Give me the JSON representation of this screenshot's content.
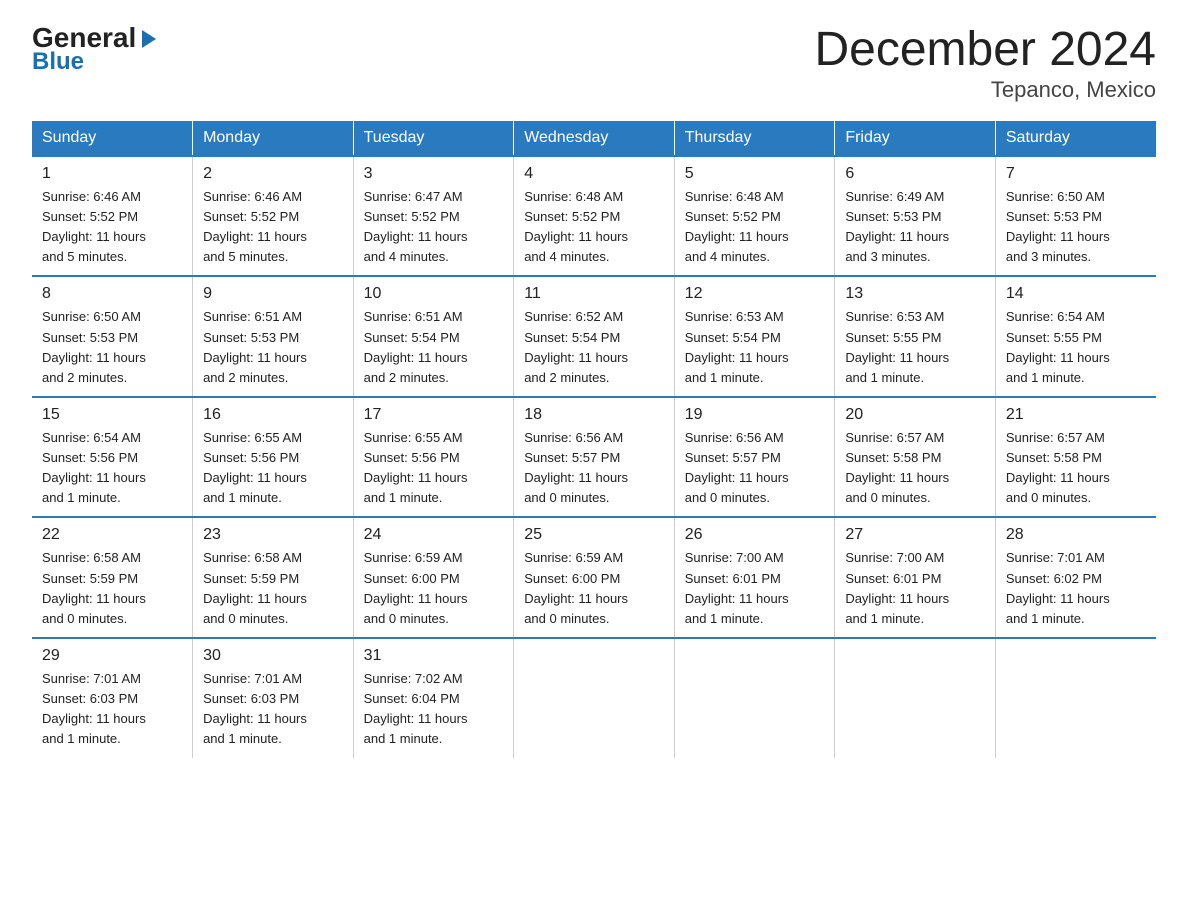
{
  "logo": {
    "general": "General",
    "arrow": "▶",
    "blue": "Blue"
  },
  "title": "December 2024",
  "subtitle": "Tepanco, Mexico",
  "headers": [
    "Sunday",
    "Monday",
    "Tuesday",
    "Wednesday",
    "Thursday",
    "Friday",
    "Saturday"
  ],
  "weeks": [
    [
      {
        "day": "1",
        "info": "Sunrise: 6:46 AM\nSunset: 5:52 PM\nDaylight: 11 hours\nand 5 minutes."
      },
      {
        "day": "2",
        "info": "Sunrise: 6:46 AM\nSunset: 5:52 PM\nDaylight: 11 hours\nand 5 minutes."
      },
      {
        "day": "3",
        "info": "Sunrise: 6:47 AM\nSunset: 5:52 PM\nDaylight: 11 hours\nand 4 minutes."
      },
      {
        "day": "4",
        "info": "Sunrise: 6:48 AM\nSunset: 5:52 PM\nDaylight: 11 hours\nand 4 minutes."
      },
      {
        "day": "5",
        "info": "Sunrise: 6:48 AM\nSunset: 5:52 PM\nDaylight: 11 hours\nand 4 minutes."
      },
      {
        "day": "6",
        "info": "Sunrise: 6:49 AM\nSunset: 5:53 PM\nDaylight: 11 hours\nand 3 minutes."
      },
      {
        "day": "7",
        "info": "Sunrise: 6:50 AM\nSunset: 5:53 PM\nDaylight: 11 hours\nand 3 minutes."
      }
    ],
    [
      {
        "day": "8",
        "info": "Sunrise: 6:50 AM\nSunset: 5:53 PM\nDaylight: 11 hours\nand 2 minutes."
      },
      {
        "day": "9",
        "info": "Sunrise: 6:51 AM\nSunset: 5:53 PM\nDaylight: 11 hours\nand 2 minutes."
      },
      {
        "day": "10",
        "info": "Sunrise: 6:51 AM\nSunset: 5:54 PM\nDaylight: 11 hours\nand 2 minutes."
      },
      {
        "day": "11",
        "info": "Sunrise: 6:52 AM\nSunset: 5:54 PM\nDaylight: 11 hours\nand 2 minutes."
      },
      {
        "day": "12",
        "info": "Sunrise: 6:53 AM\nSunset: 5:54 PM\nDaylight: 11 hours\nand 1 minute."
      },
      {
        "day": "13",
        "info": "Sunrise: 6:53 AM\nSunset: 5:55 PM\nDaylight: 11 hours\nand 1 minute."
      },
      {
        "day": "14",
        "info": "Sunrise: 6:54 AM\nSunset: 5:55 PM\nDaylight: 11 hours\nand 1 minute."
      }
    ],
    [
      {
        "day": "15",
        "info": "Sunrise: 6:54 AM\nSunset: 5:56 PM\nDaylight: 11 hours\nand 1 minute."
      },
      {
        "day": "16",
        "info": "Sunrise: 6:55 AM\nSunset: 5:56 PM\nDaylight: 11 hours\nand 1 minute."
      },
      {
        "day": "17",
        "info": "Sunrise: 6:55 AM\nSunset: 5:56 PM\nDaylight: 11 hours\nand 1 minute."
      },
      {
        "day": "18",
        "info": "Sunrise: 6:56 AM\nSunset: 5:57 PM\nDaylight: 11 hours\nand 0 minutes."
      },
      {
        "day": "19",
        "info": "Sunrise: 6:56 AM\nSunset: 5:57 PM\nDaylight: 11 hours\nand 0 minutes."
      },
      {
        "day": "20",
        "info": "Sunrise: 6:57 AM\nSunset: 5:58 PM\nDaylight: 11 hours\nand 0 minutes."
      },
      {
        "day": "21",
        "info": "Sunrise: 6:57 AM\nSunset: 5:58 PM\nDaylight: 11 hours\nand 0 minutes."
      }
    ],
    [
      {
        "day": "22",
        "info": "Sunrise: 6:58 AM\nSunset: 5:59 PM\nDaylight: 11 hours\nand 0 minutes."
      },
      {
        "day": "23",
        "info": "Sunrise: 6:58 AM\nSunset: 5:59 PM\nDaylight: 11 hours\nand 0 minutes."
      },
      {
        "day": "24",
        "info": "Sunrise: 6:59 AM\nSunset: 6:00 PM\nDaylight: 11 hours\nand 0 minutes."
      },
      {
        "day": "25",
        "info": "Sunrise: 6:59 AM\nSunset: 6:00 PM\nDaylight: 11 hours\nand 0 minutes."
      },
      {
        "day": "26",
        "info": "Sunrise: 7:00 AM\nSunset: 6:01 PM\nDaylight: 11 hours\nand 1 minute."
      },
      {
        "day": "27",
        "info": "Sunrise: 7:00 AM\nSunset: 6:01 PM\nDaylight: 11 hours\nand 1 minute."
      },
      {
        "day": "28",
        "info": "Sunrise: 7:01 AM\nSunset: 6:02 PM\nDaylight: 11 hours\nand 1 minute."
      }
    ],
    [
      {
        "day": "29",
        "info": "Sunrise: 7:01 AM\nSunset: 6:03 PM\nDaylight: 11 hours\nand 1 minute."
      },
      {
        "day": "30",
        "info": "Sunrise: 7:01 AM\nSunset: 6:03 PM\nDaylight: 11 hours\nand 1 minute."
      },
      {
        "day": "31",
        "info": "Sunrise: 7:02 AM\nSunset: 6:04 PM\nDaylight: 11 hours\nand 1 minute."
      },
      {
        "day": "",
        "info": ""
      },
      {
        "day": "",
        "info": ""
      },
      {
        "day": "",
        "info": ""
      },
      {
        "day": "",
        "info": ""
      }
    ]
  ]
}
